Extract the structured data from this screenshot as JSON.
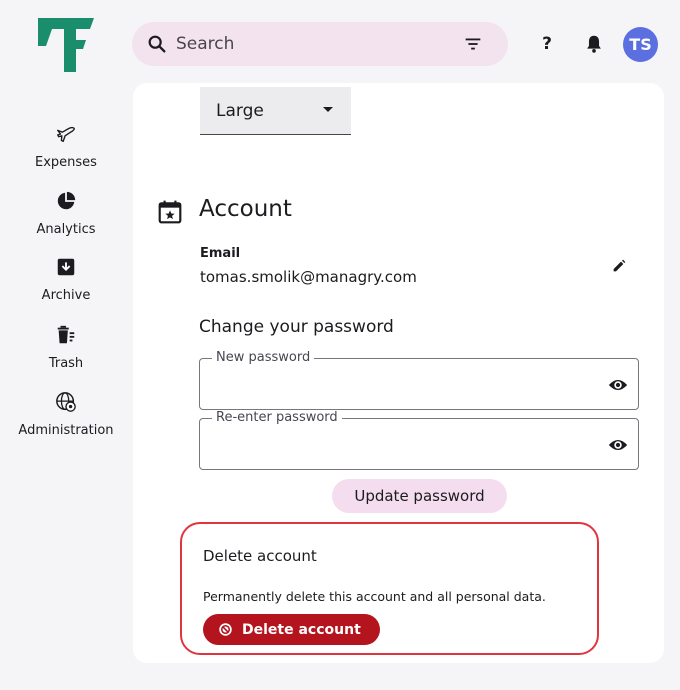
{
  "header": {
    "search_placeholder": "Search",
    "help_label": "?",
    "avatar_initials": "TS"
  },
  "sidebar": {
    "items": [
      {
        "label": "Expenses",
        "icon": "airplane-icon"
      },
      {
        "label": "Analytics",
        "icon": "pie-chart-icon"
      },
      {
        "label": "Archive",
        "icon": "archive-icon"
      },
      {
        "label": "Trash",
        "icon": "trash-icon"
      },
      {
        "label": "Administration",
        "icon": "globe-settings-icon"
      }
    ]
  },
  "main": {
    "size_select": "Large",
    "account": {
      "title": "Account",
      "email_label": "Email",
      "email_value": "tomas.smolik@managry.com"
    },
    "password": {
      "heading": "Change your password",
      "new_label": "New password",
      "reenter_label": "Re-enter password",
      "update_label": "Update password"
    },
    "delete": {
      "title": "Delete account",
      "description": "Permanently delete this account and all personal data.",
      "button_label": "Delete account"
    }
  },
  "colors": {
    "brand": "#1a8e6c",
    "search_bg": "#f3e3ef",
    "avatar_bg": "#5b6fe0",
    "danger": "#b3141d",
    "danger_outline": "#e0353f"
  }
}
